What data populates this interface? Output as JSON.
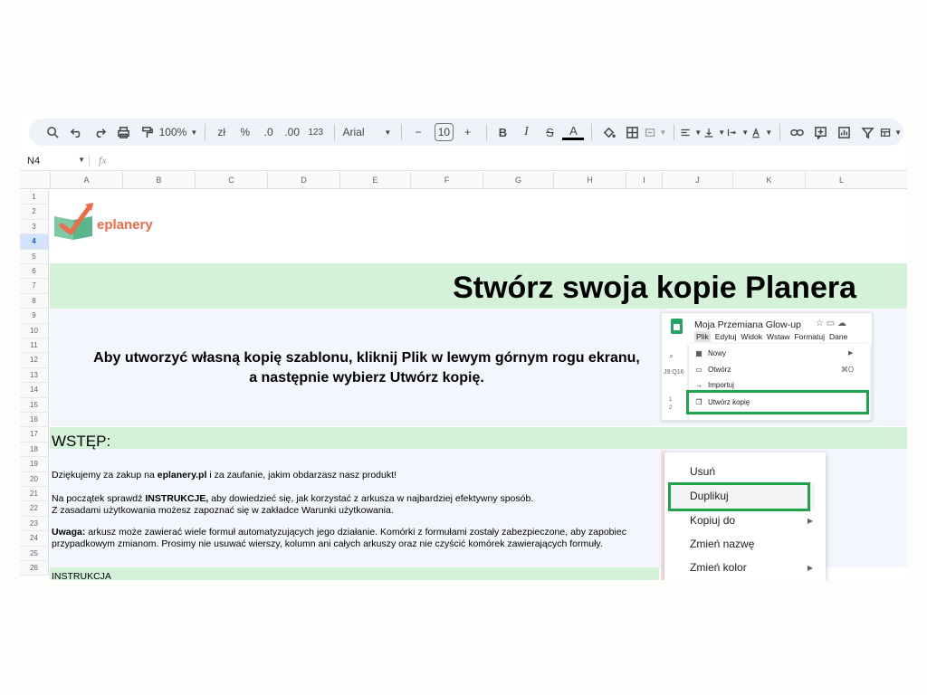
{
  "toolbar": {
    "zoom": "100%",
    "currency": "zł",
    "percent": "%",
    "dec_decrease": ".0",
    "dec_increase": ".00",
    "number_format": "123",
    "font": "Arial",
    "font_size": "10",
    "bold": "B",
    "italic": "I",
    "strike": "S",
    "text_color": "A",
    "icons": [
      "search-icon",
      "undo-icon",
      "redo-icon",
      "print-icon",
      "paint-format-icon",
      "fill-color-icon",
      "borders-icon",
      "merge-icon",
      "align-icon",
      "valign-icon",
      "wrap-icon",
      "rotate-icon",
      "link-icon",
      "comment-icon",
      "chart-icon",
      "filter-icon",
      "table-icon"
    ]
  },
  "formula_bar": {
    "cell_ref": "N4",
    "fx": "fx"
  },
  "columns": [
    "A",
    "B",
    "C",
    "D",
    "E",
    "F",
    "G",
    "H",
    "I",
    "J",
    "K",
    "L"
  ],
  "rows": [
    "1",
    "2",
    "3",
    "4",
    "5",
    "6",
    "7",
    "8",
    "9",
    "10",
    "11",
    "12",
    "13",
    "14",
    "15",
    "16",
    "17",
    "18",
    "19",
    "20",
    "21",
    "22",
    "23",
    "24",
    "25",
    "26"
  ],
  "selected_row": "4",
  "logo": {
    "text": "eplanery"
  },
  "title": "Stwórz swoja kopie Planera",
  "instruction": {
    "line1": "Aby utworzyć własną kopię szablonu, kliknij Plik w lewym górnym rogu ekranu,",
    "line2": "a następnie wybierz Utwórz kopię."
  },
  "wstep": "WSTĘP:",
  "paragraphs": {
    "p1_before": "Dziękujemy za zakup na ",
    "p1_bold": "eplanery.pl",
    "p1_after": " i za zaufanie, jakim obdarzasz nasz produkt!",
    "p2_before": "Na początek sprawdź ",
    "p2_bold": "INSTRUKCJE,",
    "p2_after": " aby dowiedzieć się, jak korzystać z arkusza w najbardziej efektywny sposób.",
    "p3": "Z zasadami użytkowania możesz zapoznać się w zakładce Warunki użytkowania.",
    "p4_bold": "Uwaga:",
    "p4_after": " arkusz może zawierać wiele formuł automatyzujących jego działanie. Komórki z formułami zostały zabezpieczone, aby zapobiec",
    "p5": "przypadkowym zmianom. Prosimy nie usuwać wierszy, kolumn ani całych arkuszy oraz nie czyścić komórek zawierających formuły."
  },
  "instrukcja": "INSTRUKCJA",
  "screenshot1": {
    "doc_title": "Moja Przemiana Glow-up",
    "menu": [
      "Plik",
      "Edytuj",
      "Widok",
      "Wstaw",
      "Formatuj",
      "Dane"
    ],
    "cell_ref": "J9:Q16",
    "items": [
      "Nowy",
      "Otwórz",
      "Importuj",
      "Utwórz kopię"
    ],
    "shortcut": "⌘O"
  },
  "screenshot2": {
    "items": [
      "Usuń",
      "Duplikuj",
      "Kopiuj do",
      "Zmień nazwę",
      "Zmień kolor"
    ]
  },
  "colors": {
    "green_band": "#d4f2d8",
    "highlight": "#1fa44a",
    "logo": "#ef6b4a"
  }
}
